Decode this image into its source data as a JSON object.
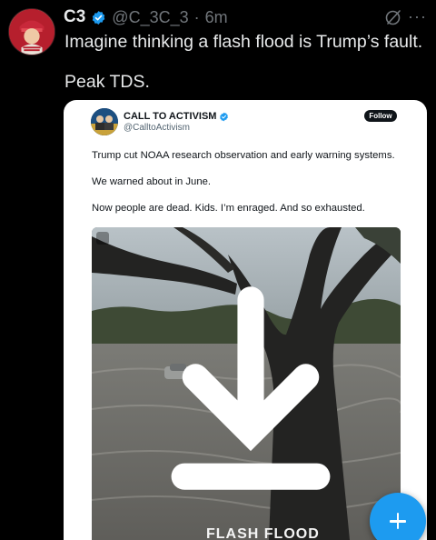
{
  "tweet": {
    "author": {
      "display_name": "C3",
      "handle": "@C_3C_3",
      "separator": "·",
      "time": "6m",
      "verified": true,
      "avatar_icon": "profile-avatar-icon"
    },
    "lines": [
      "Imagine thinking a flash flood is Trump’s fault.",
      "Peak TDS."
    ],
    "header_icons": [
      "grok-icon",
      "more-icon"
    ],
    "more_label": "···"
  },
  "quote": {
    "author": {
      "display_name": "CALL TO ACTIVISM",
      "handle": "@CalltoActivism",
      "verified": true
    },
    "follow_label": "Follow",
    "paragraphs": [
      "Trump cut NOAA research observation and early warning systems.",
      "We warned about in June.",
      "Now people are dead. Kids. I’m enraged. And so exhausted."
    ],
    "media": {
      "type": "video",
      "caption_overlay": "FLASH FLOOD",
      "icon": "download-icon"
    }
  },
  "fab": {
    "icon": "compose-plus-icon"
  },
  "colors": {
    "background": "#000000",
    "text_primary": "#e7e9ea",
    "text_secondary": "#71767b",
    "verified_blue": "#1d9bf0",
    "card_bg": "#ffffff",
    "fab_blue": "#1d9bf0"
  }
}
